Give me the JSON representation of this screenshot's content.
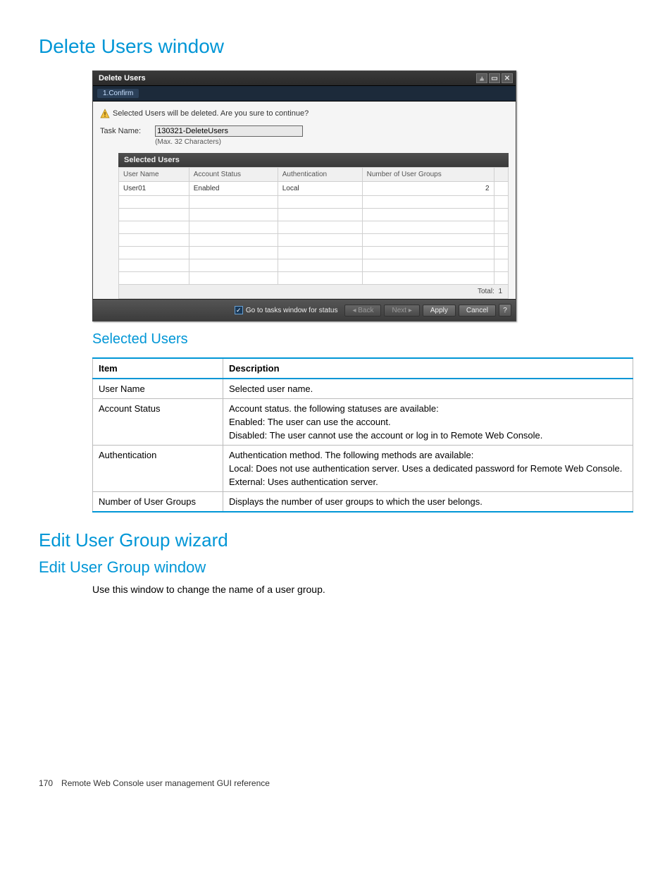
{
  "headings": {
    "delete_users_window": "Delete Users window",
    "selected_users": "Selected Users",
    "edit_user_group_wizard": "Edit User Group wizard",
    "edit_user_group_window": "Edit User Group window"
  },
  "edit_user_group_window_body": "Use this window to change the name of a user group.",
  "dialog": {
    "title": "Delete Users",
    "step": "1.Confirm",
    "warning_text": "Selected Users will be deleted. Are you sure to continue?",
    "task_name_label": "Task Name:",
    "task_name_value": "130321-DeleteUsers",
    "task_name_hint": "(Max. 32 Characters)",
    "panel_title": "Selected Users",
    "columns": {
      "user_name": "User Name",
      "account_status": "Account Status",
      "authentication": "Authentication",
      "num_groups": "Number of User Groups"
    },
    "rows": [
      {
        "user_name": "User01",
        "account_status": "Enabled",
        "authentication": "Local",
        "num_groups": "2"
      }
    ],
    "total_label": "Total:",
    "total_value": "1",
    "go_to_tasks": "Go to tasks window for status",
    "buttons": {
      "back": "◂ Back",
      "next": "Next ▸",
      "apply": "Apply",
      "cancel": "Cancel"
    }
  },
  "desc_table": {
    "header": {
      "item": "Item",
      "description": "Description"
    },
    "rows": [
      {
        "item": "User Name",
        "desc": [
          "Selected user name."
        ]
      },
      {
        "item": "Account Status",
        "desc": [
          "Account status. the following statuses are available:",
          "Enabled: The user can use the account.",
          "Disabled: The user cannot use the account or log in to Remote Web Console."
        ]
      },
      {
        "item": "Authentication",
        "desc": [
          "Authentication method. The following methods are available:",
          "Local: Does not use authentication server. Uses a dedicated password for Remote Web Console.",
          "External: Uses authentication server."
        ]
      },
      {
        "item": "Number of User Groups",
        "desc": [
          "Displays the number of user groups to which the user belongs."
        ]
      }
    ]
  },
  "footer": {
    "page": "170",
    "title": "Remote Web Console user management GUI reference"
  }
}
